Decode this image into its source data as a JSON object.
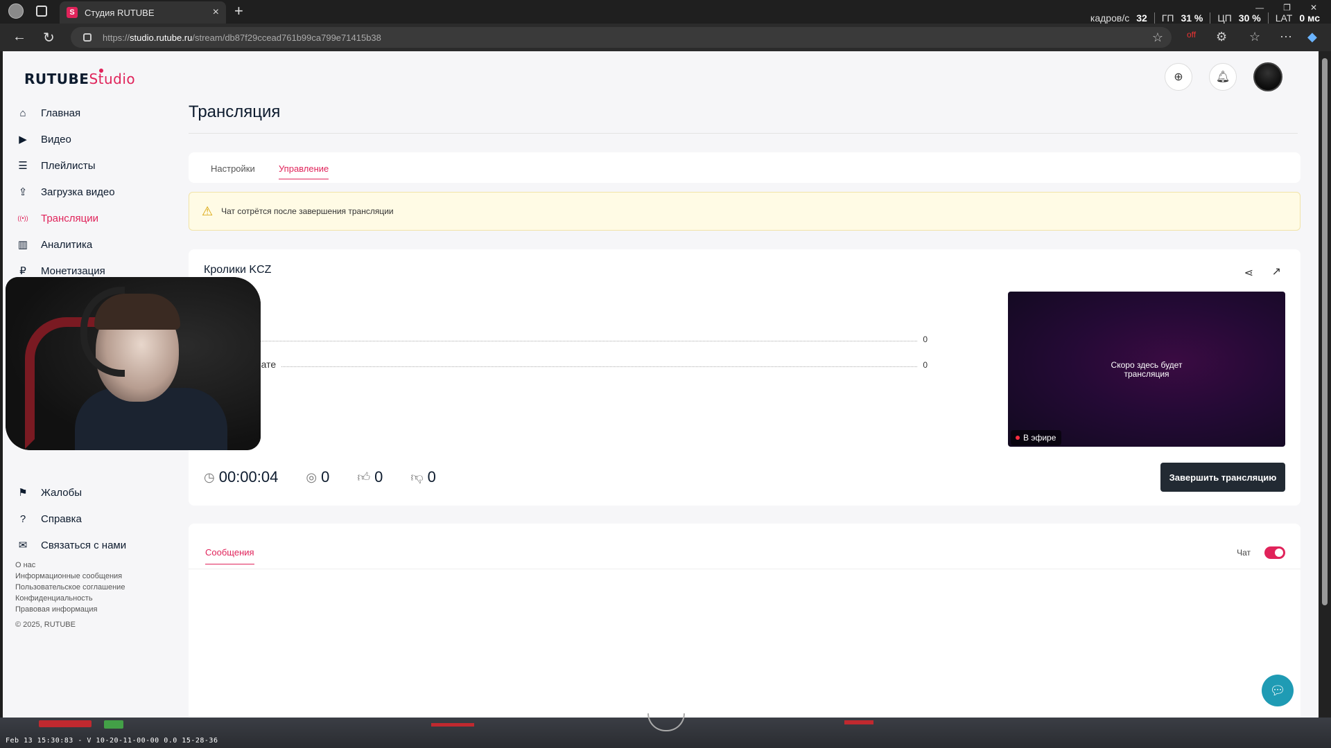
{
  "browser": {
    "tab_title": "Студия RUTUBE",
    "tab_favicon": "S",
    "url_prefix": "https://",
    "url_host": "studio.rutube.ru",
    "url_path": "/stream/db87f29ccead761b99ca799e71415b38",
    "perf": {
      "fps_label": "кадров/с",
      "fps_value": "32",
      "gpu_label": "ГП",
      "gpu_value": "31 %",
      "cpu_label": "ЦП",
      "cpu_value": "30 %",
      "lat_label": "LAT",
      "lat_value": "0 мс"
    },
    "ext_badge": "off"
  },
  "brand": {
    "rutube": "RUTUBE",
    "studio": "Studio",
    "accent": "#e0235a"
  },
  "sidebar": {
    "items": [
      {
        "label": "Главная",
        "icon": "home-icon",
        "glyph": "⌂"
      },
      {
        "label": "Видео",
        "icon": "video-icon",
        "glyph": "▶"
      },
      {
        "label": "Плейлисты",
        "icon": "playlist-icon",
        "glyph": "☰"
      },
      {
        "label": "Загрузка видео",
        "icon": "upload-icon",
        "glyph": "⇪"
      },
      {
        "label": "Трансляции",
        "icon": "broadcast-icon",
        "glyph": "((•))"
      },
      {
        "label": "Аналитика",
        "icon": "analytics-icon",
        "glyph": "▥"
      },
      {
        "label": "Монетизация",
        "icon": "ruble-icon",
        "glyph": "₽"
      }
    ],
    "bottom_items": [
      {
        "label": "Жалобы",
        "icon": "flag-icon",
        "glyph": "⚑"
      },
      {
        "label": "Справка",
        "icon": "help-icon",
        "glyph": "?"
      },
      {
        "label": "Связаться с нами",
        "icon": "mail-icon",
        "glyph": "✉"
      }
    ],
    "footer_links": [
      "О нас",
      "Информационные сообщения",
      "Пользовательское соглашение",
      "Конфиденциальность",
      "Правовая информация"
    ],
    "copyright": "© 2025, RUTUBE"
  },
  "page": {
    "title": "Трансляция",
    "tabs": [
      "Настройки",
      "Управление"
    ],
    "warning": "Чат сотрётся после завершения трансляции",
    "stream_name": "Кролики KCZ",
    "stat_rows": [
      {
        "label": "в",
        "value": "0"
      },
      {
        "label": "в чате",
        "value": "0"
      }
    ],
    "preview_text": "Скоро здесь будет трансляция",
    "live_badge": "В эфире",
    "duration": "00:00:04",
    "viewers": "0",
    "likes": "0",
    "dislikes": "0",
    "end_button": "Завершить трансляцию",
    "messages_tab": "Сообщения",
    "chat_label": "Чат",
    "chat_enabled": true
  },
  "desktop": {
    "timestamp": "Feb 13 15:30:83 - V 10-20-11-00-00 0.0 15-28-36"
  }
}
